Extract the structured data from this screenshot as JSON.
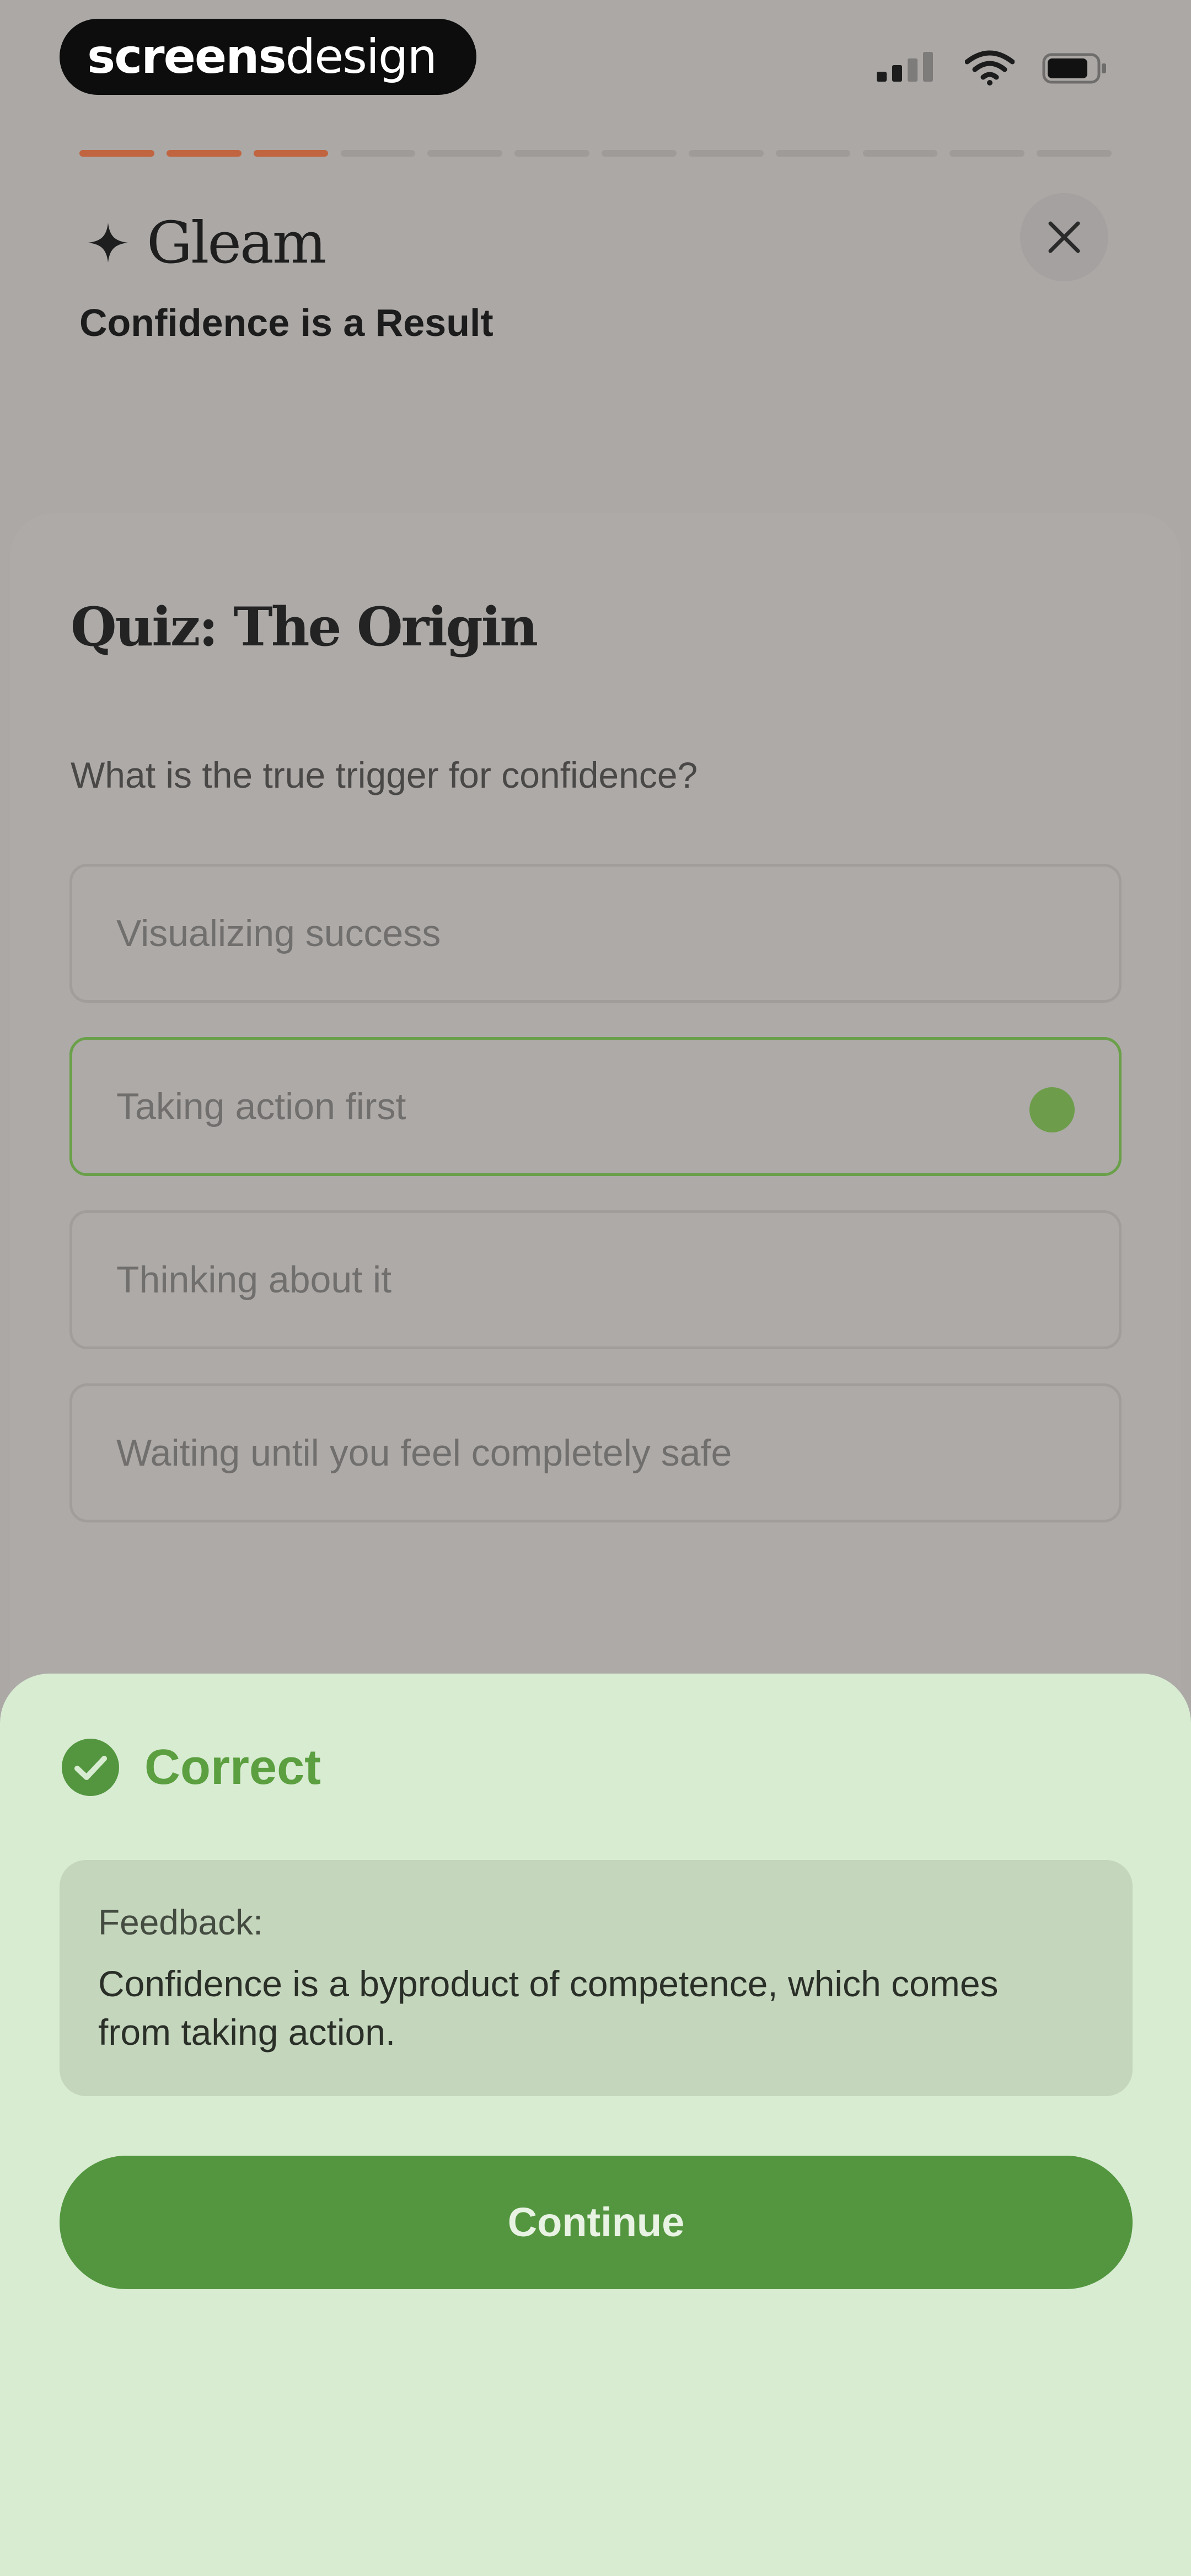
{
  "status_bar": {
    "brand_bold": "screens",
    "brand_light": "design",
    "icons": [
      "signal-icon",
      "wifi-icon",
      "battery-icon"
    ]
  },
  "progress": {
    "total_segments": 12,
    "completed_segments": 3,
    "completed_color": "#c0653f",
    "remaining_color": "#9e9b99"
  },
  "header": {
    "app_name": "Gleam",
    "logo_icon": "sparkle-icon",
    "lesson_title": "Confidence is a Result",
    "close_icon": "close-icon"
  },
  "quiz": {
    "title": "Quiz: The Origin",
    "question": "What is the true trigger for confidence?",
    "options": [
      {
        "label": "Visualizing success",
        "selected": false
      },
      {
        "label": "Taking action first",
        "selected": true
      },
      {
        "label": "Thinking about it",
        "selected": false
      },
      {
        "label": "Waiting until you feel completely safe",
        "selected": false
      }
    ]
  },
  "result": {
    "status": "Correct",
    "status_icon": "check-circle-icon",
    "status_color": "#5b9f40",
    "feedback_label": "Feedback:",
    "feedback_text": "Confidence is a byproduct of competence, which comes from taking action.",
    "continue_label": "Continue",
    "button_color": "#549640",
    "sheet_color": "#d8ecd2"
  }
}
